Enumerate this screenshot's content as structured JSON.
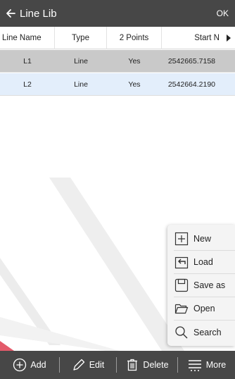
{
  "header": {
    "title": "Line Lib",
    "ok_label": "OK"
  },
  "table": {
    "columns": [
      "Line Name",
      "Type",
      "2 Points",
      "Start N"
    ],
    "rows": [
      {
        "name": "L1",
        "type": "Line",
        "two_points": "Yes",
        "start_n": "2542665.7158",
        "selected": false
      },
      {
        "name": "L2",
        "type": "Line",
        "two_points": "Yes",
        "start_n": "2542664.2190",
        "selected": true
      }
    ]
  },
  "more_menu": {
    "items": [
      {
        "label": "New",
        "icon": "plus-box-icon"
      },
      {
        "label": "Load",
        "icon": "load-icon"
      },
      {
        "label": "Save as",
        "icon": "save-icon"
      },
      {
        "label": "Open",
        "icon": "folder-open-icon"
      },
      {
        "label": "Search",
        "icon": "search-icon"
      }
    ]
  },
  "toolbar": {
    "add_label": "Add",
    "edit_label": "Edit",
    "delete_label": "Delete",
    "more_label": "More"
  },
  "colors": {
    "bar_background": "#474747",
    "selected_row": "#e3eefb",
    "highlighted_row": "#c9c9c9"
  }
}
